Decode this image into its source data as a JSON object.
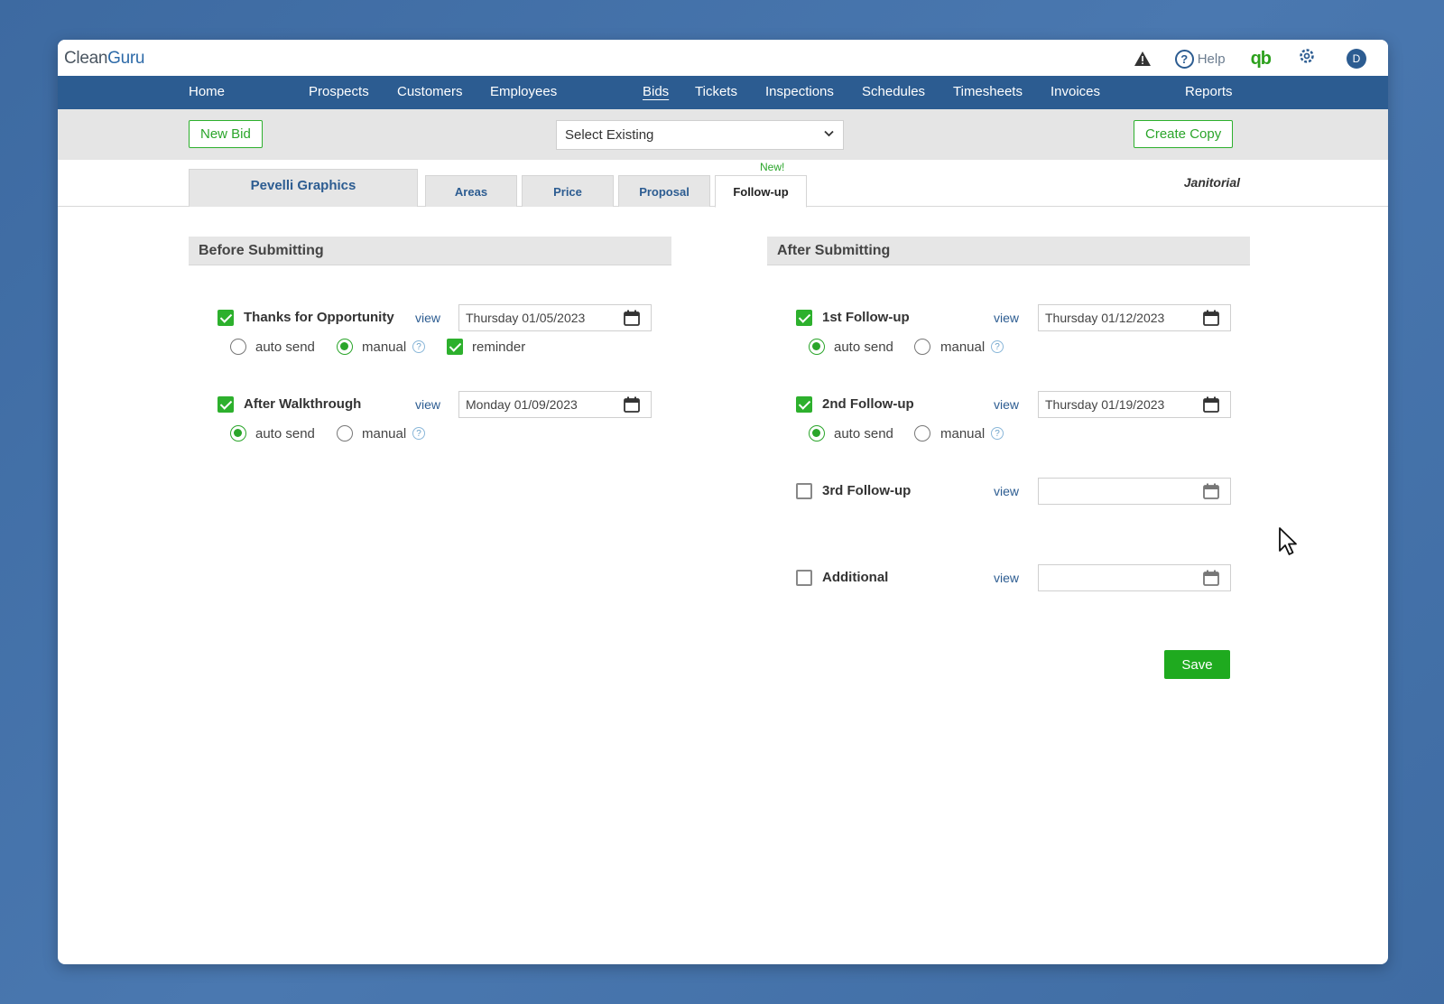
{
  "app": {
    "logo_clean": "Clean",
    "logo_guru": "Guru",
    "help_label": "Help",
    "qb_label": "qb",
    "avatar_initial": "D"
  },
  "nav": {
    "home": "Home",
    "prospects": "Prospects",
    "customers": "Customers",
    "employees": "Employees",
    "bids": "Bids",
    "tickets": "Tickets",
    "inspections": "Inspections",
    "schedules": "Schedules",
    "timesheets": "Timesheets",
    "invoices": "Invoices",
    "reports": "Reports"
  },
  "toolbar": {
    "new_bid": "New Bid",
    "select_existing": "Select Existing",
    "create_copy": "Create Copy"
  },
  "tabs": {
    "client": "Pevelli Graphics",
    "areas": "Areas",
    "price": "Price",
    "proposal": "Proposal",
    "followup": "Follow-up",
    "new_badge": "New!",
    "service_type": "Janitorial"
  },
  "before": {
    "title": "Before Submitting",
    "thanks": {
      "label": "Thanks for Opportunity",
      "checked": true,
      "view": "view",
      "date": "Thursday 01/05/2023",
      "auto_send": "auto send",
      "manual": "manual",
      "mode": "manual",
      "reminder": "reminder",
      "reminder_checked": true
    },
    "walkthrough": {
      "label": "After Walkthrough",
      "checked": true,
      "view": "view",
      "date": "Monday 01/09/2023",
      "auto_send": "auto send",
      "manual": "manual",
      "mode": "auto send"
    }
  },
  "after": {
    "title": "After Submitting",
    "first": {
      "label": "1st Follow-up",
      "checked": true,
      "view": "view",
      "date": "Thursday 01/12/2023",
      "auto_send": "auto send",
      "manual": "manual",
      "mode": "auto send"
    },
    "second": {
      "label": "2nd Follow-up",
      "checked": true,
      "view": "view",
      "date": "Thursday 01/19/2023",
      "auto_send": "auto send",
      "manual": "manual",
      "mode": "auto send"
    },
    "third": {
      "label": "3rd Follow-up",
      "checked": false,
      "view": "view",
      "date": ""
    },
    "additional": {
      "label": "Additional",
      "checked": false,
      "view": "view",
      "date": ""
    }
  },
  "save": "Save",
  "icons": [
    "warning-icon",
    "help-icon",
    "quickbooks-icon",
    "gear-icon",
    "avatar",
    "calendar-icon",
    "chevron-down-icon",
    "cursor-icon"
  ],
  "colors": {
    "nav_bg": "#2c5c91",
    "accent_green": "#2db02d",
    "background": "#3d6aa1"
  }
}
